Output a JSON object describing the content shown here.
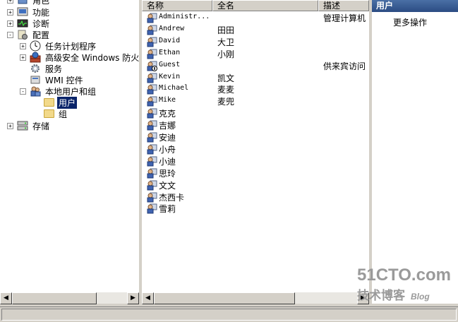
{
  "tree": {
    "items": [
      {
        "label": "角色",
        "expander": "+"
      },
      {
        "label": "功能",
        "expander": "+"
      },
      {
        "label": "诊断",
        "expander": "+"
      },
      {
        "label": "配置",
        "expander": "-"
      },
      {
        "label": "任务计划程序",
        "expander": "+"
      },
      {
        "label": "高级安全 Windows 防火墙",
        "expander": "+"
      },
      {
        "label": "服务",
        "expander": ""
      },
      {
        "label": "WMI 控件",
        "expander": ""
      },
      {
        "label": "本地用户和组",
        "expander": "-"
      },
      {
        "label": "用户",
        "expander": ""
      },
      {
        "label": "组",
        "expander": ""
      },
      {
        "label": "存储",
        "expander": "+"
      }
    ]
  },
  "list": {
    "columns": [
      "名称",
      "全名",
      "描述"
    ],
    "rows": [
      {
        "name": "Administr...",
        "fullname": "",
        "desc": "管理计算机"
      },
      {
        "name": "Andrew",
        "fullname": "田田",
        "desc": ""
      },
      {
        "name": "David",
        "fullname": "大卫",
        "desc": ""
      },
      {
        "name": "Ethan",
        "fullname": "小刚",
        "desc": ""
      },
      {
        "name": "Guest",
        "fullname": "",
        "desc": "供来宾访问"
      },
      {
        "name": "Kevin",
        "fullname": "凯文",
        "desc": ""
      },
      {
        "name": "Michael",
        "fullname": "麦麦",
        "desc": ""
      },
      {
        "name": "Mike",
        "fullname": "麦兜",
        "desc": ""
      },
      {
        "name": "克克",
        "fullname": "",
        "desc": ""
      },
      {
        "name": "吉娜",
        "fullname": "",
        "desc": ""
      },
      {
        "name": "安迪",
        "fullname": "",
        "desc": ""
      },
      {
        "name": "小舟",
        "fullname": "",
        "desc": ""
      },
      {
        "name": "小迪",
        "fullname": "",
        "desc": ""
      },
      {
        "name": "思玲",
        "fullname": "",
        "desc": ""
      },
      {
        "name": "文文",
        "fullname": "",
        "desc": ""
      },
      {
        "name": "杰西卡",
        "fullname": "",
        "desc": ""
      },
      {
        "name": "雪莉",
        "fullname": "",
        "desc": ""
      }
    ]
  },
  "actions": {
    "header": "用户",
    "more": "更多操作"
  },
  "scroll": {
    "left_arrow": "◀",
    "right_arrow": "▶"
  },
  "watermark": {
    "line1": "51CTO.com",
    "line2": "技术博客",
    "line3": "Blog"
  },
  "colors": {
    "selection": "#0a246a",
    "action_header": "#2b4c83"
  }
}
